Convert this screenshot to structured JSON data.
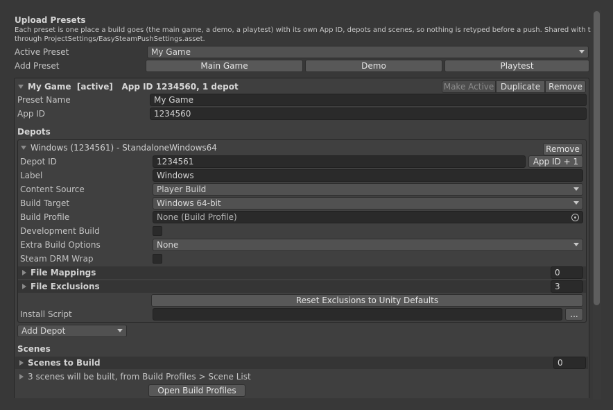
{
  "header": {
    "title": "Upload Presets",
    "description_line1": "Each preset is one place a build goes (the main game, a demo, a playtest) with its own App ID, depots and scenes, so nothing is retyped before a push. Shared with the team",
    "description_line2": "through ProjectSettings/EasySteamPushSettings.asset."
  },
  "active_preset": {
    "label": "Active Preset",
    "value": "My Game"
  },
  "add_preset": {
    "label": "Add Preset",
    "buttons": [
      "Main Game",
      "Demo",
      "Playtest"
    ]
  },
  "preset": {
    "name": "My Game",
    "badge": "[active]",
    "summary": "App ID 1234560, 1 depot",
    "buttons": {
      "make_active": "Make Active",
      "duplicate": "Duplicate",
      "remove": "Remove"
    },
    "preset_name_label": "Preset Name",
    "preset_name_value": "My Game",
    "app_id_label": "App ID",
    "app_id_value": "1234560"
  },
  "depots": {
    "heading": "Depots",
    "depot": {
      "header": "Windows (1234561)  -  StandaloneWindows64",
      "remove": "Remove",
      "depot_id_label": "Depot ID",
      "depot_id_value": "1234561",
      "app_id_plus_one": "App ID + 1",
      "label_label": "Label",
      "label_value": "Windows",
      "content_source_label": "Content Source",
      "content_source_value": "Player Build",
      "build_target_label": "Build Target",
      "build_target_value": "Windows 64-bit",
      "build_profile_label": "Build Profile",
      "build_profile_value": "None (Build Profile)",
      "development_build_label": "Development Build",
      "extra_build_options_label": "Extra Build Options",
      "extra_build_options_value": "None",
      "steam_drm_wrap_label": "Steam DRM Wrap",
      "file_mappings_label": "File Mappings",
      "file_mappings_count": "0",
      "file_exclusions_label": "File Exclusions",
      "file_exclusions_count": "3",
      "reset_exclusions": "Reset Exclusions to Unity Defaults",
      "install_script_label": "Install Script",
      "install_script_value": "",
      "browse": "..."
    },
    "add_depot": "Add Depot"
  },
  "scenes": {
    "heading": "Scenes",
    "scenes_to_build_label": "Scenes to Build",
    "scenes_to_build_count": "0",
    "info": "3 scenes will be built, from Build Profiles > Scene List",
    "open_build_profiles": "Open Build Profiles"
  },
  "icons": {
    "foldout_open": "triangle-down-icon",
    "foldout_closed": "triangle-right-icon",
    "dropdown": "chevron-down-icon",
    "object_picker": "object-picker-icon"
  },
  "colors": {
    "background": "#383838",
    "field": "#2a2a2a",
    "button": "#585858",
    "text": "#c4c4c4"
  }
}
